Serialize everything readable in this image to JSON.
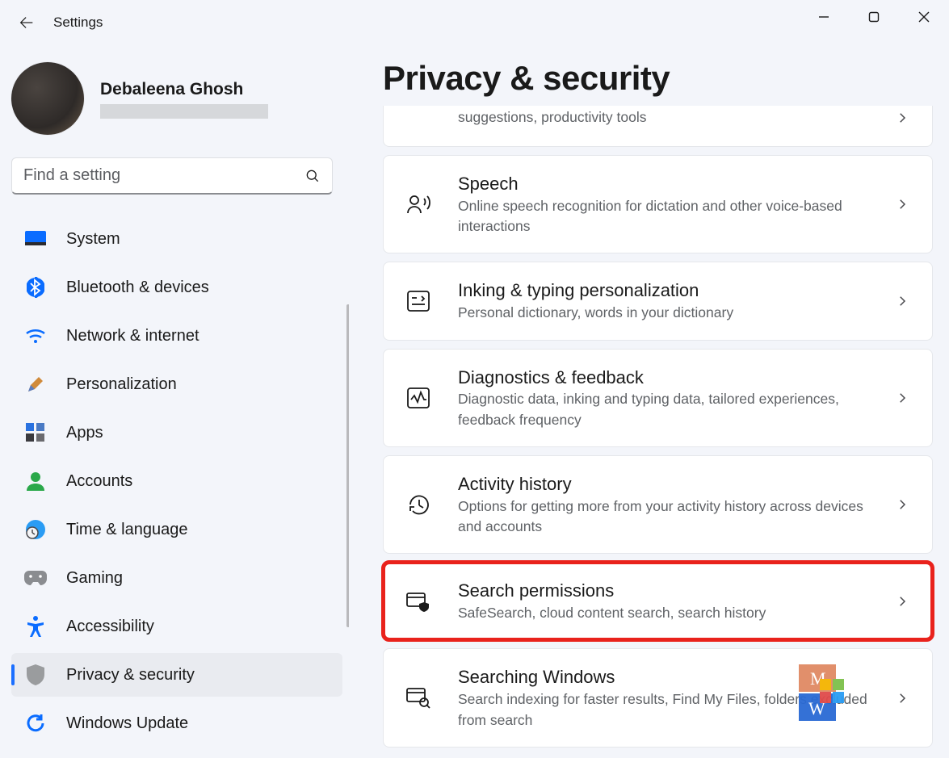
{
  "app_title": "Settings",
  "user": {
    "name": "Debaleena Ghosh"
  },
  "search": {
    "placeholder": "Find a setting"
  },
  "nav": {
    "items": [
      {
        "label": "System"
      },
      {
        "label": "Bluetooth & devices"
      },
      {
        "label": "Network & internet"
      },
      {
        "label": "Personalization"
      },
      {
        "label": "Apps"
      },
      {
        "label": "Accounts"
      },
      {
        "label": "Time & language"
      },
      {
        "label": "Gaming"
      },
      {
        "label": "Accessibility"
      },
      {
        "label": "Privacy & security"
      },
      {
        "label": "Windows Update"
      }
    ],
    "active_index": 9
  },
  "page": {
    "heading": "Privacy & security",
    "cards": [
      {
        "title": "",
        "subtitle": "suggestions, productivity tools"
      },
      {
        "title": "Speech",
        "subtitle": "Online speech recognition for dictation and other voice-based interactions"
      },
      {
        "title": "Inking & typing personalization",
        "subtitle": "Personal dictionary, words in your dictionary"
      },
      {
        "title": "Diagnostics & feedback",
        "subtitle": "Diagnostic data, inking and typing data, tailored experiences, feedback frequency"
      },
      {
        "title": "Activity history",
        "subtitle": "Options for getting more from your activity history across devices and accounts"
      },
      {
        "title": "Search permissions",
        "subtitle": "SafeSearch, cloud content search, search history"
      },
      {
        "title": "Searching Windows",
        "subtitle": "Search indexing for faster results, Find My Files, folders excluded from search"
      }
    ],
    "highlight_index": 5
  }
}
